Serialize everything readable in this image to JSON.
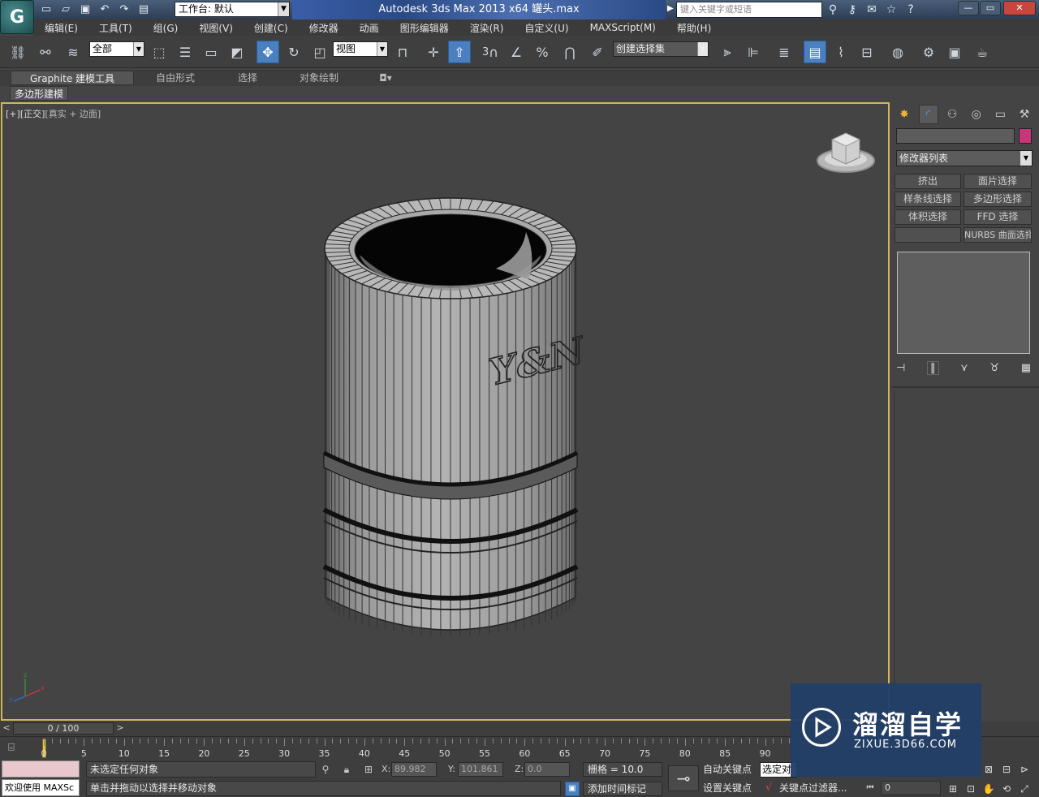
{
  "app": {
    "title": "Autodesk 3ds Max  2013 x64        罐头.max",
    "workspace_label": "工作台: 默认",
    "search_placeholder": "键入关键字或短语"
  },
  "menu": [
    "编辑(E)",
    "工具(T)",
    "组(G)",
    "视图(V)",
    "创建(C)",
    "修改器",
    "动画",
    "图形编辑器",
    "渲染(R)",
    "自定义(U)",
    "MAXScript(M)",
    "帮助(H)"
  ],
  "toolbar": {
    "selection_filter": "全部",
    "ref_coord": "视图",
    "named_selection": "创建选择集",
    "snap_3d_label": "3"
  },
  "ribbon": {
    "tabs": [
      "Graphite 建模工具",
      "自由形式",
      "选择",
      "对象绘制"
    ],
    "active_tab": "Graphite 建模工具",
    "sub_panel": "多边形建模"
  },
  "viewport": {
    "label_plus": "[+]",
    "label_view": "[正交]",
    "label_shading": "[真实 + 边面]",
    "logo_text": "Y&N",
    "colors": {
      "border_active": "#d2b65a",
      "background": "#444444"
    }
  },
  "command_panel": {
    "modifier_list": "修改器列表",
    "buttons": [
      "挤出",
      "面片选择",
      "样条线选择",
      "多边形选择",
      "体积选择",
      "FFD 选择",
      "",
      "NURBS 曲面选择"
    ],
    "object_color": "#c8357b"
  },
  "timeline": {
    "frame_display": "0 / 100",
    "ticks": [
      0,
      5,
      10,
      15,
      20,
      25,
      30,
      35,
      40,
      45,
      50,
      55,
      60,
      65,
      70,
      75,
      80,
      85,
      90
    ],
    "max_frame": 100
  },
  "status": {
    "maxscript": "欢迎使用 MAXSc",
    "selection_info": "未选定任何对象",
    "prompt": "单击并拖动以选择并移动对象",
    "x_label": "X:",
    "x_value": "89.982",
    "y_label": "Y:",
    "y_value": "101.861",
    "z_label": "Z:",
    "z_value": "0.0",
    "grid": "栅格 = 10.0",
    "add_time_tag": "添加时间标记",
    "auto_key": "自动关键点",
    "set_key": "设置关键点",
    "selected_obj": "选定对",
    "key_filters": "关键点过滤器...",
    "frame": "0"
  },
  "watermark": {
    "cn": "溜溜自学",
    "en": "ZIXUE.3D66.COM"
  }
}
